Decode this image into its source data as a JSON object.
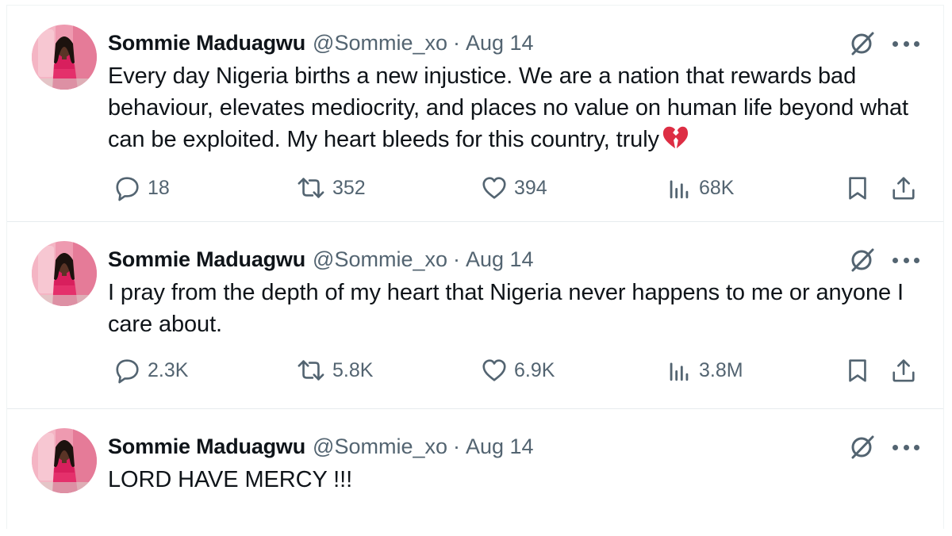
{
  "tweets": [
    {
      "name": "Sommie Maduagwu",
      "handle": "@Sommie_xo",
      "separator": "·",
      "date": "Aug 14",
      "text": "Every day Nigeria births a new injustice. We are a nation that rewards bad behaviour, elevates mediocrity, and places no value on human life beyond what can be exploited. My heart bleeds for this country, truly",
      "emoji": "broken-heart-icon",
      "stats": {
        "replies": "18",
        "reposts": "352",
        "likes": "394",
        "views": "68K"
      }
    },
    {
      "name": "Sommie Maduagwu",
      "handle": "@Sommie_xo",
      "separator": "·",
      "date": "Aug 14",
      "text": "I pray from the depth of my heart that Nigeria never happens to me or anyone I care about.",
      "stats": {
        "replies": "2.3K",
        "reposts": "5.8K",
        "likes": "6.9K",
        "views": "3.8M"
      }
    },
    {
      "name": "Sommie Maduagwu",
      "handle": "@Sommie_xo",
      "separator": "·",
      "date": "Aug 14",
      "text": "LORD HAVE MERCY !!!"
    }
  ],
  "icons": {
    "grok": "grok-icon",
    "more": "more-icon",
    "reply": "reply-icon",
    "repost": "repost-icon",
    "like": "like-icon",
    "views": "views-icon",
    "bookmark": "bookmark-icon",
    "share": "share-icon"
  },
  "colors": {
    "text": "#0f1419",
    "secondary": "#536471",
    "border": "#eff3f4",
    "avatar_bg": "#e8567f",
    "emoji": "#e0304e"
  }
}
